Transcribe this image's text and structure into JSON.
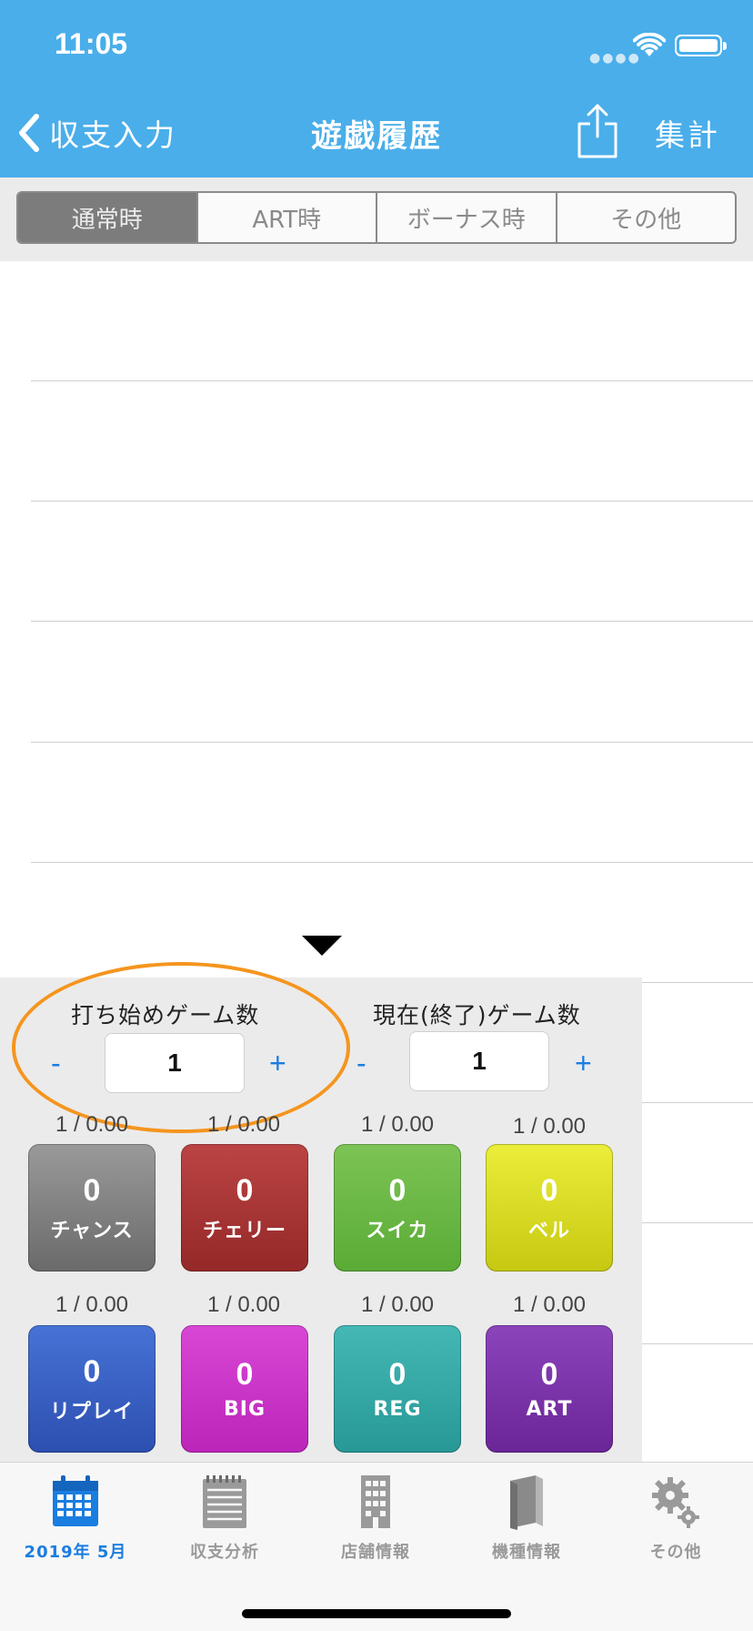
{
  "status_bar": {
    "time": "11:05"
  },
  "nav": {
    "back_label": "収支入力",
    "title": "遊戯履歴",
    "total_label": "集計"
  },
  "segments": {
    "items": [
      "通常時",
      "ART時",
      "ボーナス時",
      "その他"
    ],
    "selected": "通常時"
  },
  "counter": {
    "start_label": "打ち始めゲーム数",
    "current_label": "現在(終了)ゲーム数",
    "minus": "-",
    "plus": "+",
    "start_value": "1",
    "current_value": "1"
  },
  "buttons": [
    {
      "rate": "1 / 0.00",
      "count": "0",
      "name": "チャンス",
      "color": "#7a7a7a"
    },
    {
      "rate": "1 / 0.00",
      "count": "0",
      "name": "チェリー",
      "color": "#a73434"
    },
    {
      "rate": "1 / 0.00",
      "count": "0",
      "name": "スイカ",
      "color": "#6cba45"
    },
    {
      "rate": "1 / 0.00",
      "count": "0",
      "name": "ベル",
      "color": "#d6d81c"
    },
    {
      "rate": "1 / 0.00",
      "count": "0",
      "name": "リプレイ",
      "color": "#3860c6"
    },
    {
      "rate": "1 / 0.00",
      "count": "0",
      "name": "BIG",
      "color": "#cb35c9"
    },
    {
      "rate": "1 / 0.00",
      "count": "0",
      "name": "REG",
      "color": "#35a8a5"
    },
    {
      "rate": "1 / 0.00",
      "count": "0",
      "name": "ART",
      "color": "#7b33a9"
    }
  ],
  "tabs": [
    {
      "label": "2019年 5月",
      "icon": "calendar-icon",
      "active": true
    },
    {
      "label": "収支分析",
      "icon": "notepad-icon",
      "active": false
    },
    {
      "label": "店舗情報",
      "icon": "building-icon",
      "active": false
    },
    {
      "label": "機種情報",
      "icon": "book-icon",
      "active": false
    },
    {
      "label": "その他",
      "icon": "gears-icon",
      "active": false
    }
  ]
}
